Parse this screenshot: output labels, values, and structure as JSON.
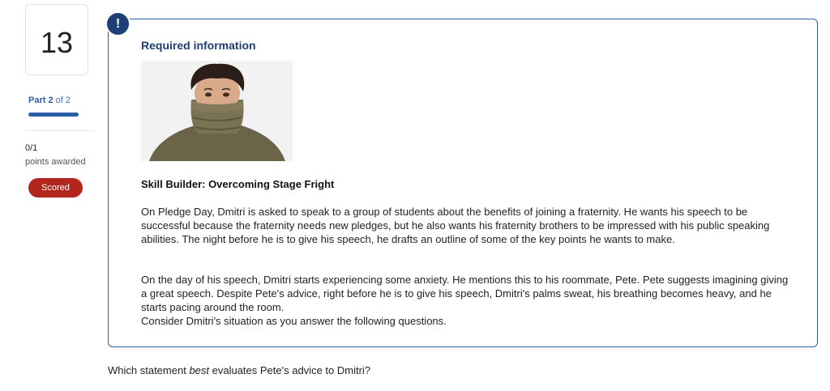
{
  "question": {
    "number": "13",
    "part_label": "Part",
    "part_current": "2",
    "part_of": "of 2",
    "part_progress": 1.0,
    "score": "0/1",
    "score_caption": "points awarded",
    "status_badge": "Scored",
    "prompt_before": "Which statement ",
    "prompt_emphasis": "best",
    "prompt_after": " evaluates Pete's advice to Dmitri?"
  },
  "info_panel": {
    "alert_icon": "!",
    "title": "Required information",
    "image_icon": "photo-man-turtleneck",
    "section_title": "Skill Builder: Overcoming Stage Fright",
    "paragraph_1": "On Pledge Day, Dmitri is asked to speak to a group of students about the benefits of joining a fraternity. He wants his speech to be successful because the fraternity needs new pledges, but he also wants his fraternity brothers to be impressed with his public speaking abilities. The night before he is to give his speech, he drafts an outline of some of the key points he wants to make.",
    "paragraph_2": "On the day of his speech, Dmitri starts experiencing some anxiety. He mentions this to his roommate, Pete. Pete suggests imagining giving a great speech. Despite Pete's advice, right before he is to give his speech, Dmitri's palms sweat, his breathing becomes heavy, and he starts pacing around the room.",
    "paragraph_3": "Consider Dmitri's situation as you answer the following questions."
  },
  "colors": {
    "accent": "#2a5ea8",
    "title_navy": "#1e3f75",
    "scored_badge": "#b3261e"
  }
}
